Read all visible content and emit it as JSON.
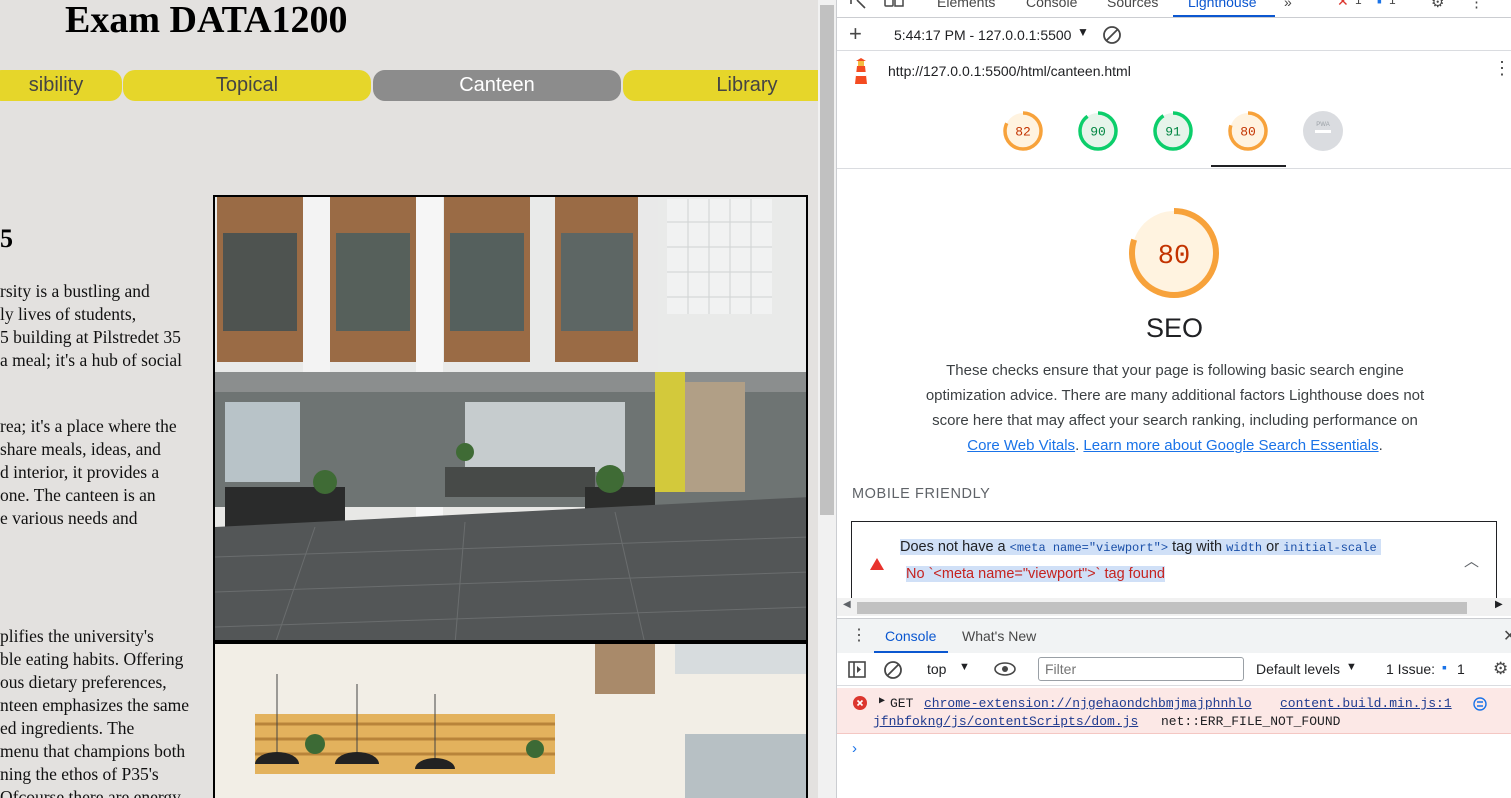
{
  "page": {
    "title": "Exam DATA1200",
    "nav": [
      "sibility",
      "Topical",
      "Canteen",
      "Library"
    ],
    "active_nav": "Canteen",
    "section_number": "5",
    "paragraphs": [
      "rsity is a bustling and\nly lives of students,\n5 building at Pilstredet 35\na meal; it's a hub of social",
      "rea; it's a place where the\nshare meals, ideas, and\nd interior, it provides a\none. The canteen is an\ne various needs and",
      "plifies the university's\nble eating habits. Offering\nous dietary preferences,\nnteen emphasizes the same\ned ingredients. The\nmenu that champions both\nning the ethos of P35's\nOfcourse there are energy"
    ]
  },
  "devtools": {
    "tabs": [
      "Elements",
      "Console",
      "Sources",
      "Lighthouse"
    ],
    "active_tab": "Lighthouse",
    "issue_badges": {
      "errors": "1",
      "issues": "1"
    },
    "lighthouse": {
      "report_selector": "5:44:17 PM - 127.0.0.1:5500",
      "url": "http://127.0.0.1:5500/html/canteen.html",
      "scores": [
        {
          "value": "82",
          "color": "#f7a23b",
          "text_color": "#c33300"
        },
        {
          "value": "90",
          "color": "#0cce6b",
          "text_color": "#018642"
        },
        {
          "value": "91",
          "color": "#0cce6b",
          "text_color": "#018642"
        },
        {
          "value": "80",
          "color": "#f7a23b",
          "text_color": "#c33300"
        }
      ],
      "pwa_label": "PWA",
      "big_score": "80",
      "category": "SEO",
      "description": "These checks ensure that your page is following basic search engine optimization advice. There are many additional factors Lighthouse does not score here that may affect your search ranking, including performance on",
      "link1": "Core Web Vitals",
      "link2": "Learn more about Google Search Essentials",
      "section_heading": "MOBILE FRIENDLY",
      "audit": {
        "title_prefix": "Does not have a ",
        "title_code1": "<meta name=\"viewport\">",
        "title_mid": " tag with ",
        "title_code2": "width",
        "title_or": " or ",
        "title_code3": "initial-scale",
        "explanation": "No `<meta name=\"viewport\">` tag found"
      }
    },
    "drawer": {
      "tabs": [
        "Console",
        "What's New"
      ],
      "context": "top",
      "filter_placeholder": "Filter",
      "levels": "Default levels",
      "issues_label": "1 Issue:",
      "issues_count": "1",
      "error": {
        "method": "GET",
        "url_part1": "chrome-extension://njgehaondchbmjmajphnhlo",
        "url_part2": "jfnbfokng/js/contentScripts/dom.js",
        "source": "content.build.min.js:1",
        "message": "net::ERR_FILE_NOT_FOUND"
      }
    }
  }
}
